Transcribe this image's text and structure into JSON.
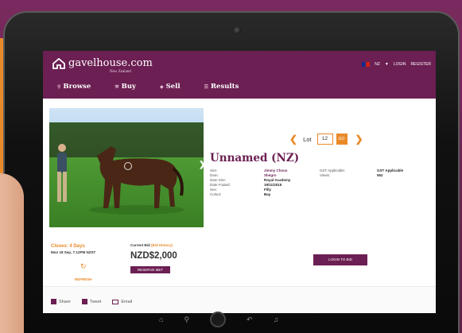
{
  "site": {
    "logo_text": "gavelhouse.com",
    "logo_sub": "New Zealand",
    "country": "NZ",
    "login": "LOGIN",
    "register": "REGISTER"
  },
  "nav": [
    {
      "label": "Browse",
      "icon": "search-icon"
    },
    {
      "label": "Buy",
      "icon": "gavel-icon"
    },
    {
      "label": "Sell",
      "icon": "tag-icon"
    },
    {
      "label": "Results",
      "icon": "list-icon"
    }
  ],
  "lot": {
    "label": "Lot",
    "number": "12",
    "go": "GO"
  },
  "listing": {
    "title": "Unnamed (NZ)",
    "details": [
      {
        "label": "Sire:",
        "value": "Jimmy Choux"
      },
      {
        "label": "Dam:",
        "value": "Shegro"
      },
      {
        "label": "Dam Sire:",
        "value": "Royal Academy"
      },
      {
        "label": "Date Foaled:",
        "value": "19/11/2015"
      },
      {
        "label": "Sex:",
        "value": "Filly"
      },
      {
        "label": "Colour:",
        "value": "Bay"
      }
    ],
    "gst_label": "GST Applicable:",
    "gst_value": "GST Applicable",
    "views_label": "Views:",
    "views_value": "552"
  },
  "bid": {
    "closes": "Closes: 4 Days",
    "closes_date": "Mon 18 Sep, 7:12PM NZST",
    "refresh": "REFRESH",
    "current_label": "Current Bid",
    "history_label": "(Bid History)",
    "amount": "NZD$2,000",
    "reserve": "RESERVE MET",
    "login_to_bid": "LOGIN TO BID"
  },
  "share": {
    "share": "Share",
    "tweet": "Tweet",
    "email": "Email"
  },
  "colors": {
    "brand": "#6b1f52",
    "accent": "#e98a2a"
  }
}
